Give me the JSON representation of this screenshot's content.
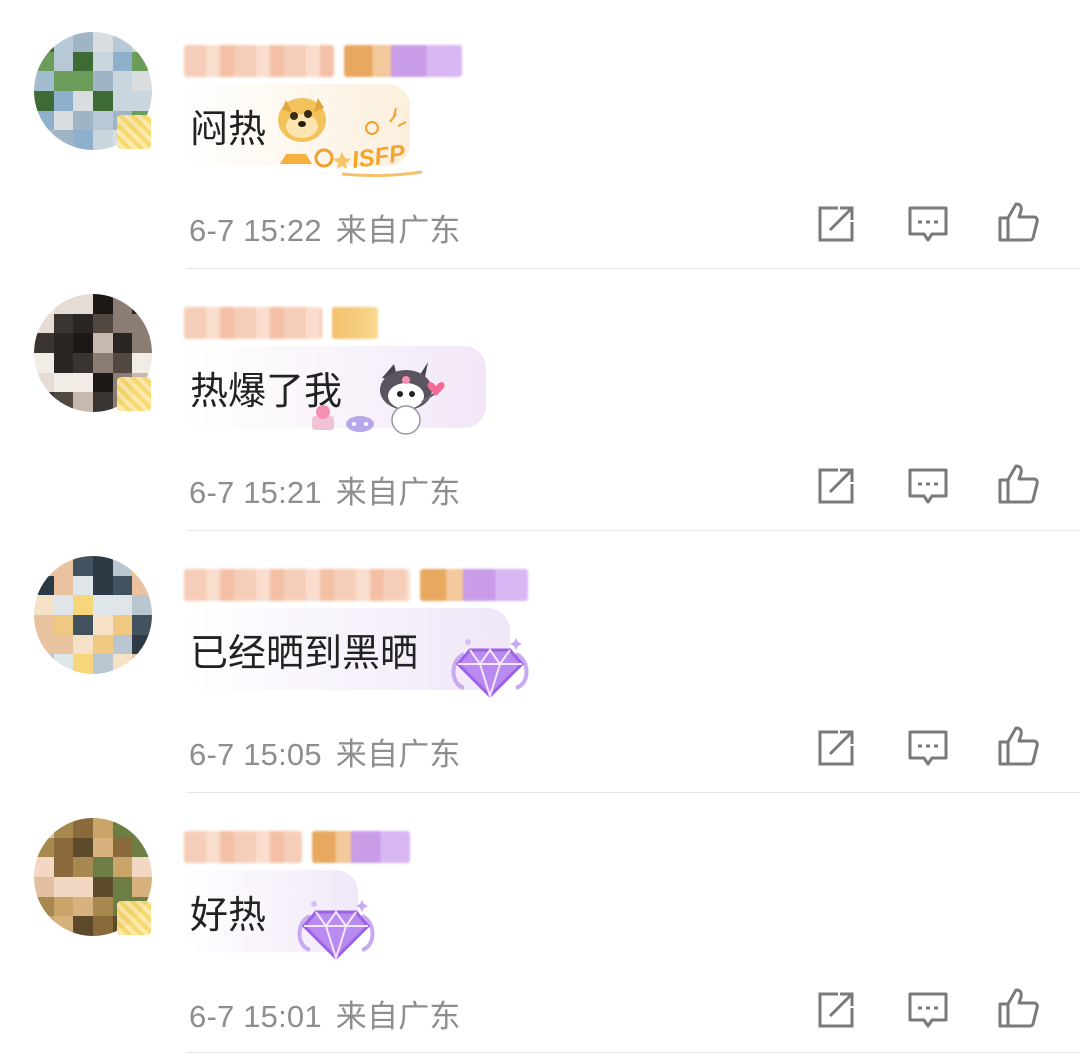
{
  "comments": [
    {
      "text": "闷热",
      "time": "6-7 15:22",
      "location": "来自广东",
      "sticker": "doge-isfp",
      "sticker_text": "ISFP",
      "avatar_palette": [
        "#b7c8d6",
        "#8fb0cc",
        "#a3bccf",
        "#c9d6de",
        "#6b9c5a",
        "#3e6b35",
        "#d9dde0",
        "#9fb4c4"
      ]
    },
    {
      "text": "热爆了我",
      "time": "6-7 15:21",
      "location": "来自广东",
      "sticker": "kuromi",
      "avatar_palette": [
        "#2a2624",
        "#514842",
        "#e6dcd5",
        "#8c7d74",
        "#f2ece6",
        "#3b3531",
        "#c7b9ae",
        "#1b1816"
      ]
    },
    {
      "text": "已经晒到黑晒",
      "time": "6-7 15:05",
      "location": "来自广东",
      "sticker": "purple-gem",
      "avatar_palette": [
        "#2c3a45",
        "#f4e1c6",
        "#f6d67a",
        "#e9c3a0",
        "#dfe6ea",
        "#42525e",
        "#f0c882",
        "#b9c6cf"
      ]
    },
    {
      "text": "好热",
      "time": "6-7 15:01",
      "location": "来自广东",
      "sticker": "purple-gem",
      "avatar_palette": [
        "#8a6a3a",
        "#c9a56a",
        "#e1bfa0",
        "#6d7e45",
        "#f2d8c2",
        "#a7884e",
        "#d7b17e",
        "#5d4a2b"
      ]
    }
  ],
  "icons": {
    "share": "share-icon",
    "reply": "reply-icon",
    "like": "like-icon"
  },
  "colors": {
    "text": "#222222",
    "meta": "#8e8e8e",
    "icon": "#7a7a7a",
    "divider": "#e6e6e6"
  }
}
